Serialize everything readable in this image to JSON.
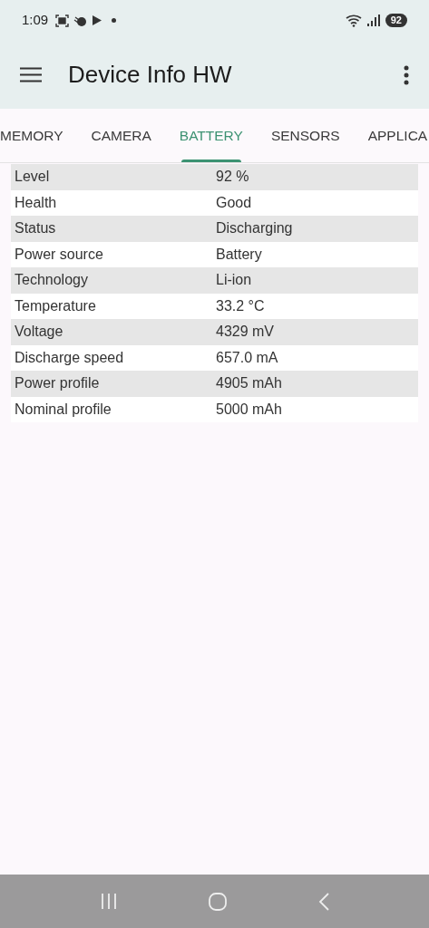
{
  "status_bar": {
    "time": "1:09",
    "battery": "92"
  },
  "app_bar": {
    "title": "Device Info HW"
  },
  "tabs": [
    {
      "label": "MEMORY",
      "selected": false
    },
    {
      "label": "CAMERA",
      "selected": false
    },
    {
      "label": "BATTERY",
      "selected": true
    },
    {
      "label": "SENSORS",
      "selected": false
    },
    {
      "label": "APPLICA",
      "selected": false
    }
  ],
  "table": {
    "rows": [
      {
        "label": "Level",
        "value": "92 %"
      },
      {
        "label": "Health",
        "value": "Good"
      },
      {
        "label": "Status",
        "value": "Discharging"
      },
      {
        "label": "Power source",
        "value": "Battery"
      },
      {
        "label": "Technology",
        "value": "Li-ion"
      },
      {
        "label": "Temperature",
        "value": "33.2 °C"
      },
      {
        "label": "Voltage",
        "value": "4329 mV"
      },
      {
        "label": "Discharge speed",
        "value": "657.0 mA"
      },
      {
        "label": "Power profile",
        "value": "4905 mAh"
      },
      {
        "label": "Nominal profile",
        "value": "5000 mAh"
      }
    ]
  }
}
